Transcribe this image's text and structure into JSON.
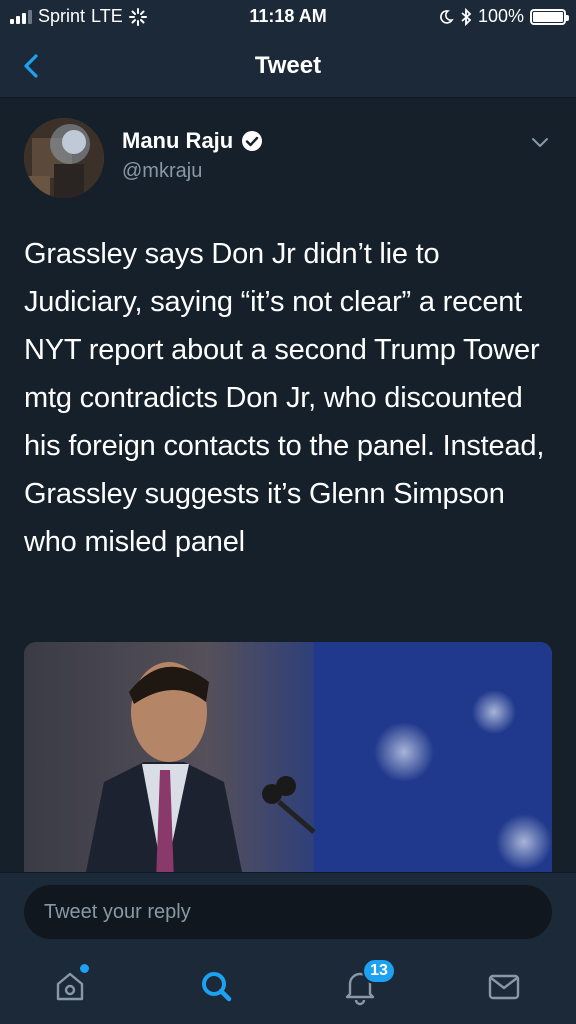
{
  "status_bar": {
    "carrier": "Sprint",
    "network": "LTE",
    "time": "11:18 AM",
    "battery": "100%"
  },
  "nav": {
    "title": "Tweet"
  },
  "tweet": {
    "author_name": "Manu Raju",
    "author_handle": "@mkraju",
    "verified": true,
    "text": "Grassley says Don Jr didn’t lie to Judiciary, saying “it’s not clear” a recent NYT report about a second Trump Tower mtg contradicts Don Jr, who discounted his foreign contacts to the panel. Instead, Grassley suggests it’s Glenn Simpson who misled panel"
  },
  "reply": {
    "placeholder": "Tweet your reply"
  },
  "tab_bar": {
    "notifications_count": "13",
    "items": [
      "home-icon",
      "search-icon",
      "notifications-icon",
      "messages-icon"
    ]
  },
  "colors": {
    "background": "#15202b",
    "bar": "#1c2938",
    "accent": "#1da1f2",
    "secondary_text": "#8899a6"
  }
}
